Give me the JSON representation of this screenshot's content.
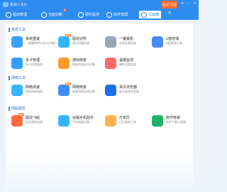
{
  "window": {
    "title": "驱动人生8",
    "promo": "驱动人生会员"
  },
  "tabs": [
    {
      "label": "驱动管理"
    },
    {
      "label": "全面诊断",
      "badge": "新"
    },
    {
      "label": "硬件监测"
    },
    {
      "label": "软件管理"
    },
    {
      "label": "工具箱"
    }
  ],
  "sections": [
    {
      "title": "系统工具",
      "tools": [
        {
          "name": "系统重装",
          "desc": "一键重装Windows系统",
          "icon": "reinstall-icon",
          "color": "#3aa0ff"
        },
        {
          "name": "驱动诊所",
          "desc": "驱动问题修复",
          "icon": "clinic-icon",
          "color": "#2fb6ff",
          "tag": "推荐"
        },
        {
          "name": "一键装机",
          "desc": "全新安装系统",
          "icon": "install-icon",
          "color": "#9aa6b2"
        },
        {
          "name": "U盘管家",
          "desc": "U盘管理工具",
          "icon": "usb-icon",
          "color": "#4c8bf5"
        },
        {
          "name": "多卡管理",
          "desc": "多卡切换管理",
          "icon": "multicard-icon",
          "color": "#33a0ff"
        },
        {
          "name": "游戏修复",
          "desc": "修复游戏运行问题",
          "icon": "game-icon",
          "color": "#ff9a2e"
        },
        {
          "name": "温度监测",
          "desc": "硬件温度监测",
          "icon": "temperature-icon",
          "color": "#ff6b6b"
        }
      ]
    },
    {
      "title": "网络工具",
      "tools": [
        {
          "name": "网络测速",
          "desc": "测试网络速度",
          "icon": "speedtest-icon",
          "color": "#38b6ff"
        },
        {
          "name": "网络修复",
          "desc": "修复网络连接问题",
          "icon": "netfix-icon",
          "color": "#3f8cff",
          "tag": "推荐"
        },
        {
          "name": "百页浏览器",
          "desc": "安全快速浏览器",
          "icon": "browser-icon",
          "color": "#1e6fe8"
        }
      ]
    },
    {
      "title": "便民服务",
      "tools": [
        {
          "name": "驱动飞船",
          "desc": "驱动更新加速",
          "icon": "rocket-icon",
          "color": "#ff6a3d",
          "tag": "推荐"
        },
        {
          "name": "远程手机助手",
          "desc": "手机电脑互联",
          "icon": "phone-icon",
          "color": "#35b5ff"
        },
        {
          "name": "万年历",
          "desc": "日历查询工具",
          "icon": "calendar-icon",
          "color": "#ffb44d"
        },
        {
          "name": "软件管家",
          "desc": "软件下载与管理",
          "icon": "softmgr-icon",
          "color": "#1fb26b"
        }
      ]
    }
  ]
}
